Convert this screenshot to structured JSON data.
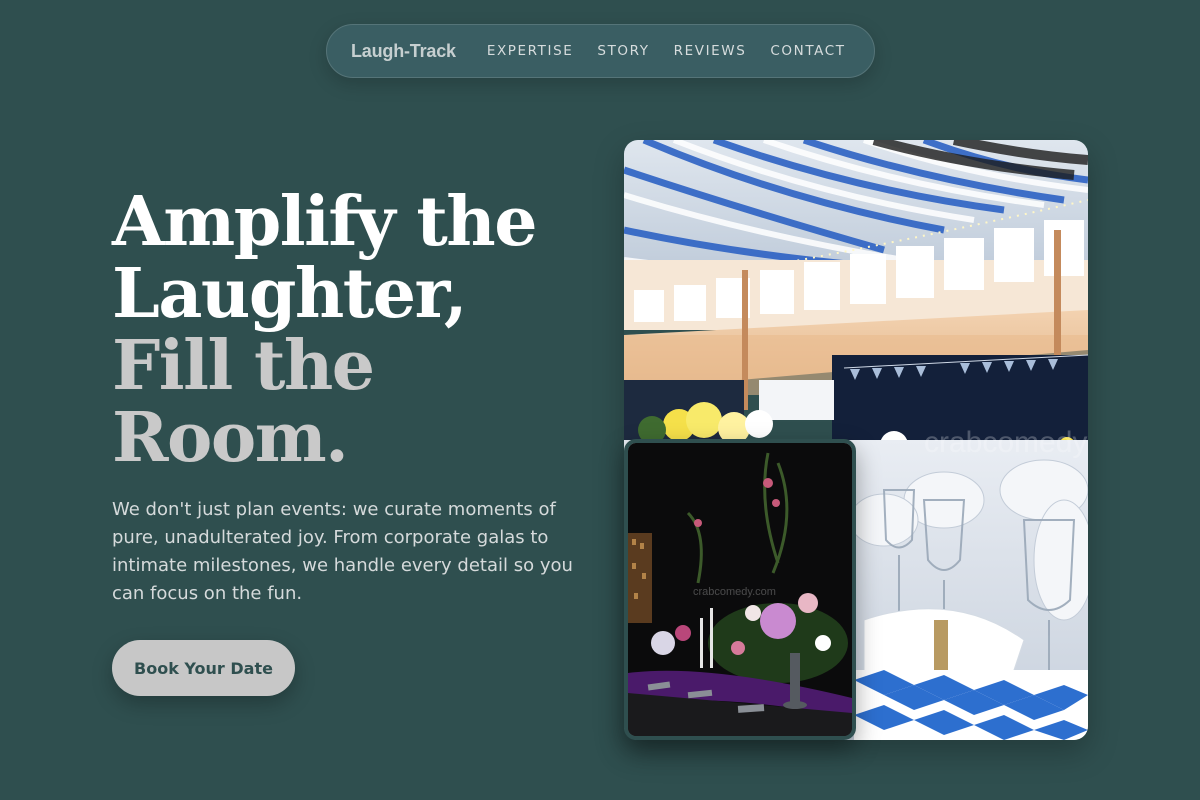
{
  "nav": {
    "brand": "Laugh-Track",
    "links": [
      "EXPERTISE",
      "STORY",
      "REVIEWS",
      "CONTACT"
    ]
  },
  "hero": {
    "title_line1a": "Amplify the",
    "title_line1b": "Laughter,",
    "title_line2a": "Fill the",
    "title_line2b": "Room.",
    "description": "We don't just plan events: we curate moments of pure, unadulterated joy. From corporate galas to intimate milestones, we handle every detail so you can focus on the fun.",
    "cta_label": "Book Your Date"
  },
  "images": {
    "main_alt": "Decorated banquet hall with blue and white ceiling streamers and set tables",
    "inset_alt": "Dark dining table with floral centerpiece and candles",
    "main_watermark": "crabcomedy.com",
    "inset_watermark": "crabcomedy.com"
  },
  "colors": {
    "background": "#2f4f4f",
    "accent_light": "#c9c9c9",
    "nav_bg": "#3a5e63"
  }
}
